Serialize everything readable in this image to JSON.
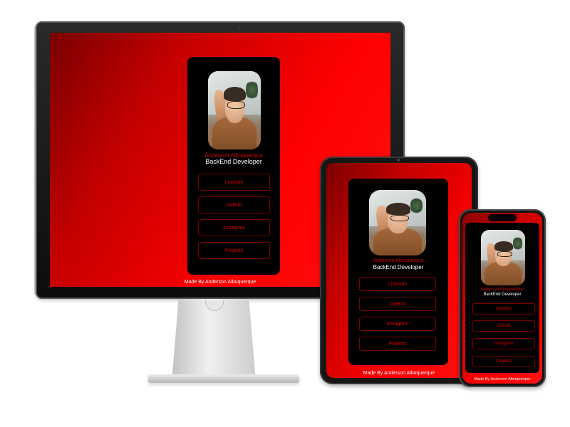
{
  "profile": {
    "name": "Anderson Albuquerque",
    "role": "BackEnd Developer",
    "links": [
      {
        "label": "Linkedin"
      },
      {
        "label": "GitHub"
      },
      {
        "label": "Instagram"
      },
      {
        "label": "Projects"
      }
    ],
    "footer": "Made By Anderson Albuquerque"
  },
  "colors": {
    "accent": "#ff0000",
    "card": "#000000",
    "button_text": "#e00000",
    "name_text": "#d40000"
  },
  "devices": [
    "desktop-monitor",
    "tablet",
    "phone"
  ]
}
